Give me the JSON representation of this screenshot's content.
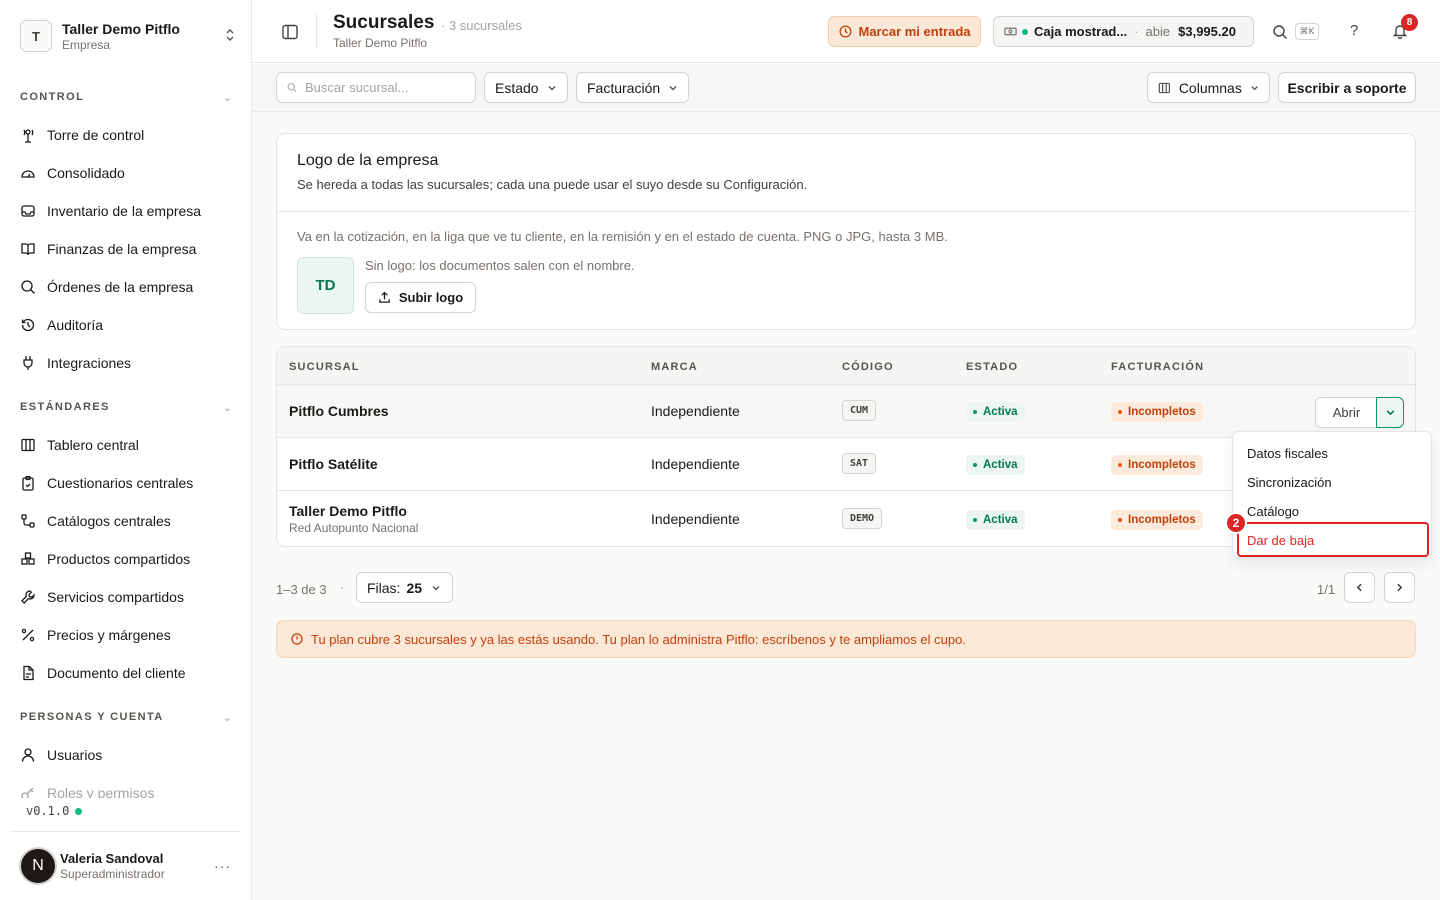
{
  "company": {
    "initial": "T",
    "name": "Taller Demo Pitflo",
    "type": "Empresa"
  },
  "sidebar": {
    "sections": [
      {
        "title": "CONTROL",
        "items": [
          {
            "label": "Torre de control",
            "icon": "tower-icon"
          },
          {
            "label": "Consolidado",
            "icon": "gauge-icon"
          },
          {
            "label": "Inventario de la empresa",
            "icon": "inbox-icon"
          },
          {
            "label": "Finanzas de la empresa",
            "icon": "book-icon"
          },
          {
            "label": "Órdenes de la empresa",
            "icon": "search-icon"
          },
          {
            "label": "Auditoría",
            "icon": "history-icon"
          },
          {
            "label": "Integraciones",
            "icon": "plug-icon"
          }
        ]
      },
      {
        "title": "ESTÁNDARES",
        "items": [
          {
            "label": "Tablero central",
            "icon": "columns-icon"
          },
          {
            "label": "Cuestionarios centrales",
            "icon": "clipboard-icon"
          },
          {
            "label": "Catálogos centrales",
            "icon": "nodes-icon"
          },
          {
            "label": "Productos compartidos",
            "icon": "boxes-icon"
          },
          {
            "label": "Servicios compartidos",
            "icon": "wrench-icon"
          },
          {
            "label": "Precios y márgenes",
            "icon": "percent-icon"
          },
          {
            "label": "Documento del cliente",
            "icon": "document-icon"
          }
        ]
      },
      {
        "title": "PERSONAS Y CUENTA",
        "items": [
          {
            "label": "Usuarios",
            "icon": "user-icon"
          },
          {
            "label": "Roles y permisos",
            "icon": "key-icon"
          }
        ]
      }
    ],
    "version": "v0.1.0"
  },
  "user": {
    "initial": "N",
    "name": "Valeria Sandoval",
    "role": "Superadministrador",
    "more": "···"
  },
  "topbar": {
    "title": "Sucursales",
    "count": "· 3 sucursales",
    "subtitle": "Taller Demo Pitflo",
    "punch_label": "Marcar mi entrada",
    "cash": {
      "name": "Caja mostrad...",
      "sep": "·",
      "status": "abie",
      "amount": "$3,995.20"
    },
    "kbd": "⌘K",
    "help": "?",
    "notifications": "8"
  },
  "filters": {
    "search_placeholder": "Buscar sucursal...",
    "estado": "Estado",
    "facturacion": "Facturación",
    "columnas": "Columnas",
    "support": "Escribir a soporte"
  },
  "logo": {
    "title": "Logo de la empresa",
    "desc": "Se hereda a todas las sucursales; cada una puede usar el suyo desde su Configuración.",
    "note": "Va en la cotización, en la liga que ve tu cliente, en la remisión y en el estado de cuenta. PNG o JPG, hasta 3 MB.",
    "initials": "TD",
    "nologo": "Sin logo: los documentos salen con el nombre.",
    "upload": "Subir logo"
  },
  "table": {
    "headers": [
      "SUCURSAL",
      "MARCA",
      "CÓDIGO",
      "ESTADO",
      "FACTURACIÓN"
    ],
    "rows": [
      {
        "name": "Pitflo Cumbres",
        "sub": "",
        "brand": "Independiente",
        "code": "CUM",
        "status": "Activa",
        "billing": "Incompletos"
      },
      {
        "name": "Pitflo Satélite",
        "sub": "",
        "brand": "Independiente",
        "code": "SAT",
        "status": "Activa",
        "billing": "Incompletos"
      },
      {
        "name": "Taller Demo Pitflo",
        "sub": "Red Autopunto Nacional",
        "brand": "Independiente",
        "code": "DEMO",
        "status": "Activa",
        "billing": "Incompletos"
      }
    ],
    "open_label": "Abrir"
  },
  "pager": {
    "info": "1–3 de 3",
    "dot": "·",
    "rows_label": "Filas:",
    "rows_value": "25",
    "page": "1/1"
  },
  "plan_notice": "Tu plan cubre 3 sucursales y ya las estás usando. Tu plan lo administra Pitflo: escríbenos y te ampliamos el cupo.",
  "menu": {
    "items": [
      "Datos fiscales",
      "Sincronización",
      "Catálogo",
      "Dar de baja"
    ],
    "marker": "2"
  },
  "colors": {
    "accent": "#059669",
    "warning": "#c2410c",
    "danger": "#dc2626"
  }
}
